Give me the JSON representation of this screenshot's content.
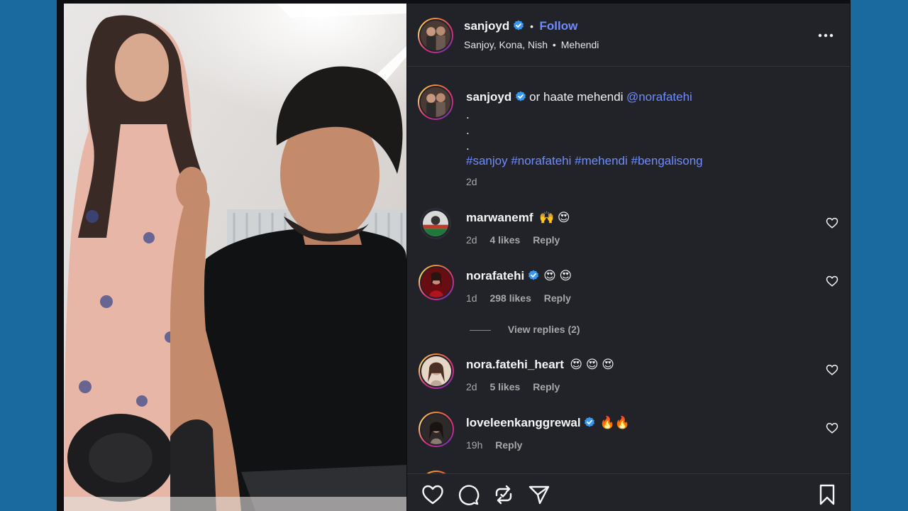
{
  "post": {
    "author": "sanjoyd",
    "follow_label": "Follow",
    "separator": "•",
    "subtitle_people": "Sanjoy, Kona, Nish",
    "subtitle_audio": "Mehendi",
    "caption_text": "or haate mehendi",
    "caption_mention": "@norafatehi",
    "caption_dots": [
      ".",
      ".",
      "."
    ],
    "hashtags": "#sanjoy #norafatehi #mehendi #bengalisong",
    "age": "2d"
  },
  "comments": [
    {
      "user": "marwanemf",
      "verified": false,
      "text": "🙌 😍",
      "age": "2d",
      "likes": "4 likes",
      "reply": "Reply"
    },
    {
      "user": "norafatehi",
      "verified": true,
      "text": "😍 😍",
      "age": "1d",
      "likes": "298 likes",
      "reply": "Reply",
      "view_replies": "View replies (2)"
    },
    {
      "user": "nora.fatehi_heart",
      "verified": false,
      "text": "😍 😍 😍",
      "age": "2d",
      "likes": "5 likes",
      "reply": "Reply"
    },
    {
      "user": "loveleenkanggrewal",
      "verified": true,
      "text": "🔥🔥",
      "age": "19h",
      "likes": "",
      "reply": "Reply"
    }
  ],
  "icons": {
    "more": "more-horizontal-icon",
    "like": "heart-icon",
    "comment": "comment-icon",
    "repost": "repost-icon",
    "share": "send-icon",
    "save": "bookmark-icon",
    "verified": "verified-badge-icon"
  },
  "colors": {
    "background": "#1a6a9f",
    "panel": "#212329",
    "link": "#6e8cff",
    "verified": "#3897f0"
  }
}
